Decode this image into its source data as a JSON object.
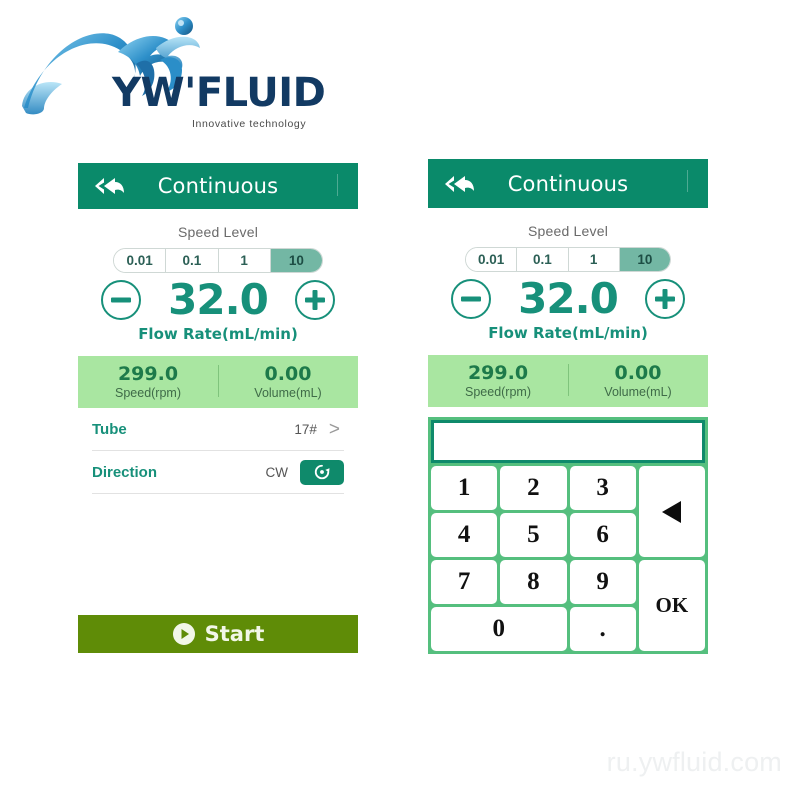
{
  "brand": {
    "wordmark": "YW'FLUID",
    "tagline": "Innovative technology",
    "logo_icon": "water-splash-logo",
    "color": "#123a63"
  },
  "watermark": "ru.ywfluid.com",
  "theme": {
    "teal": "#0a8a6a",
    "teal_text": "#17907a",
    "band_green": "#a9e6a1",
    "keypad_green": "#55bf7e",
    "start_olive": "#5f8c07",
    "segment_active": "#73b7a4"
  },
  "panel_left": {
    "header": {
      "title": "Continuous",
      "back_icon": "back-double-arrow-icon"
    },
    "speed": {
      "label": "Speed Level",
      "options": [
        "0.01",
        "0.1",
        "1",
        "10"
      ],
      "selected": "10"
    },
    "flow": {
      "decrement_icon": "minus-circle-icon",
      "increment_icon": "plus-circle-icon",
      "value": "32.0",
      "caption": "Flow Rate(mL/min)"
    },
    "summary": [
      {
        "value": "299.0",
        "caption": "Speed(rpm)"
      },
      {
        "value": "0.00",
        "caption": "Volume(mL)"
      }
    ],
    "rows": [
      {
        "label": "Tube",
        "value": "17#",
        "chevron": ">",
        "icon": "chevron-right-icon"
      },
      {
        "label": "Direction",
        "value": "CW",
        "icon": "clockwise-rotation-icon"
      }
    ],
    "start": {
      "label": "Start",
      "icon": "play-circle-icon"
    }
  },
  "panel_right": {
    "header": {
      "title": "Continuous",
      "back_icon": "back-double-arrow-icon"
    },
    "speed": {
      "label": "Speed Level",
      "options": [
        "0.01",
        "0.1",
        "1",
        "10"
      ],
      "selected": "10"
    },
    "flow": {
      "decrement_icon": "minus-circle-icon",
      "increment_icon": "plus-circle-icon",
      "value": "32.0",
      "caption": "Flow Rate(mL/min)"
    },
    "summary": [
      {
        "value": "299.0",
        "caption": "Speed(rpm)"
      },
      {
        "value": "0.00",
        "caption": "Volume(mL)"
      }
    ],
    "keypad": {
      "display_value": "",
      "display_placeholder": "",
      "keys": [
        "1",
        "2",
        "3",
        "4",
        "5",
        "6",
        "7",
        "8",
        "9",
        "0",
        "."
      ],
      "backspace_icon": "backspace-triangle-icon",
      "ok_label": "OK"
    }
  }
}
